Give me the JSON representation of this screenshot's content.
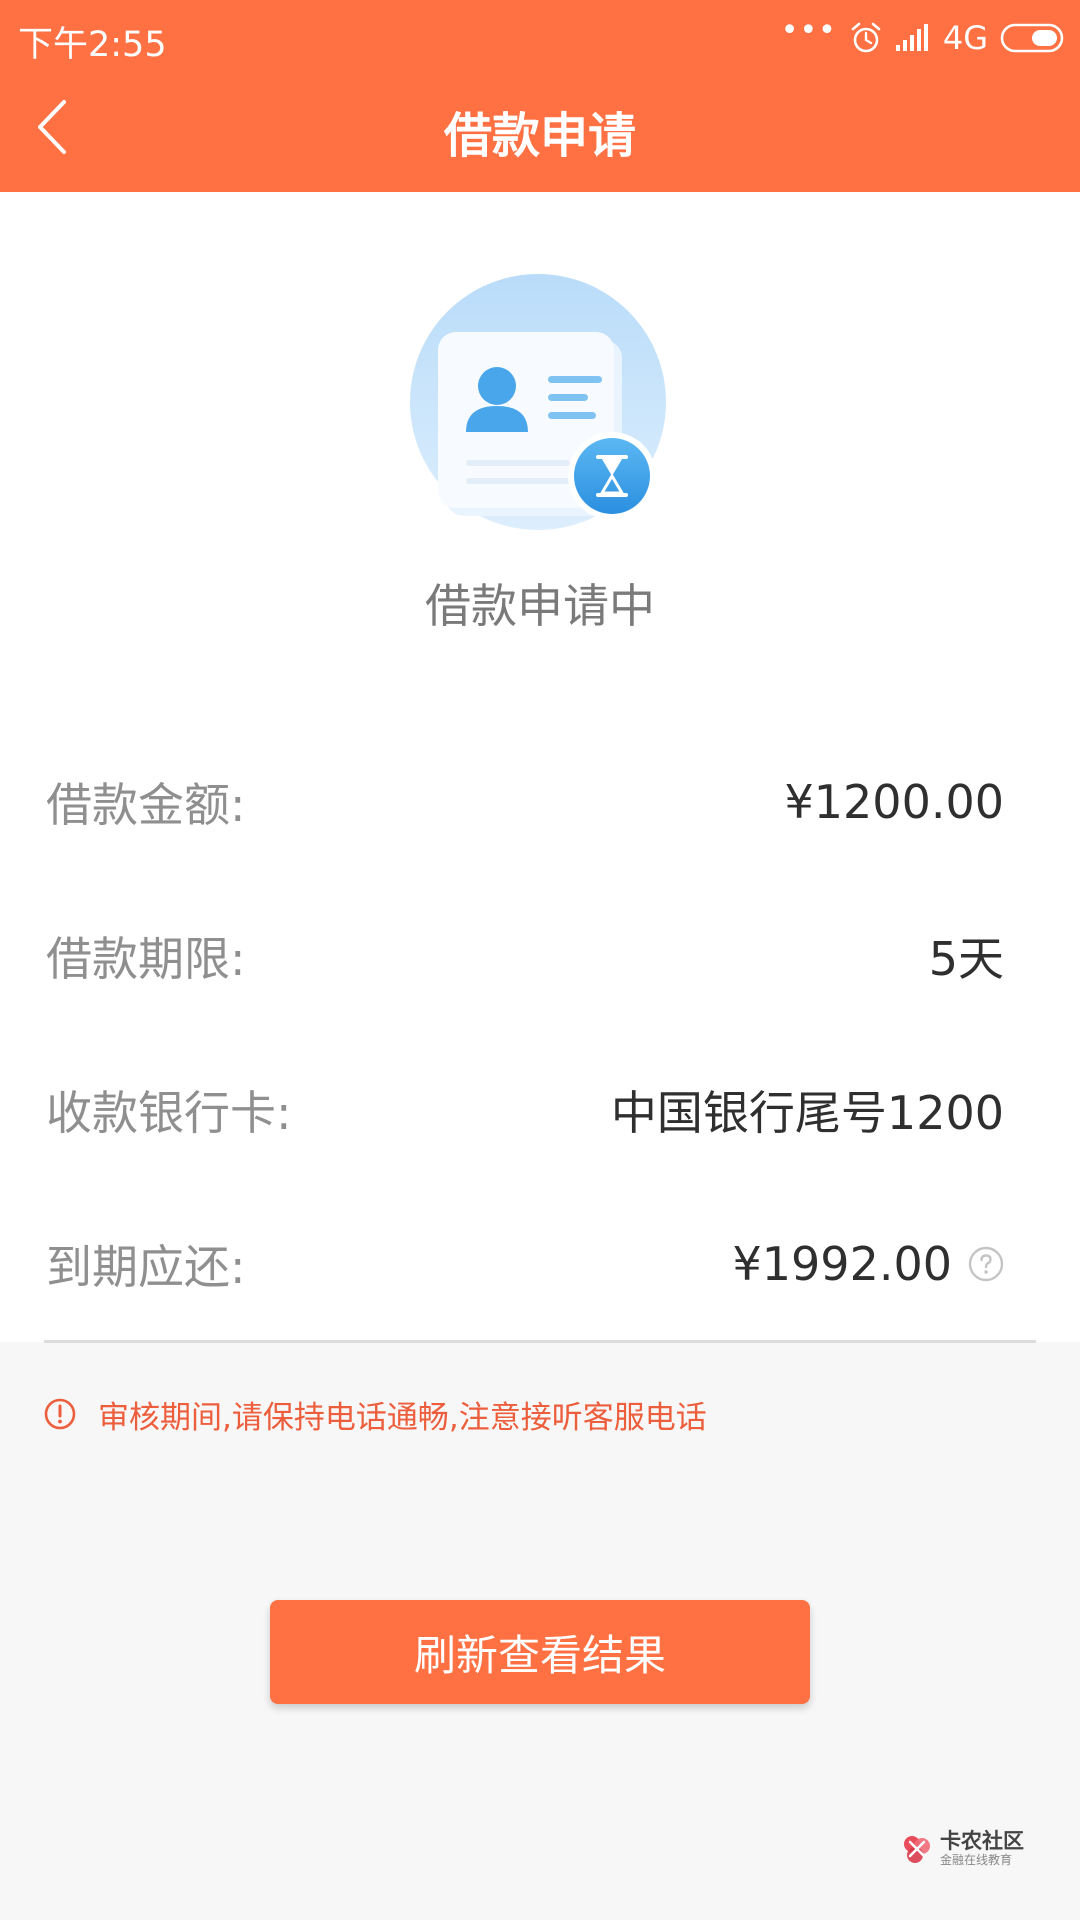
{
  "status_bar": {
    "time": "下午2:55",
    "network": "4G"
  },
  "header": {
    "title": "借款申请",
    "back_icon": "chevron-left-icon"
  },
  "application": {
    "illustration_icon": "id-card-hourglass-icon",
    "status_text": "借款申请中",
    "rows": [
      {
        "label": "借款金额:",
        "value": "¥1200.00"
      },
      {
        "label": "借款期限:",
        "value": "5天"
      },
      {
        "label": "收款银行卡:",
        "value": "中国银行尾号1200"
      },
      {
        "label": "到期应还:",
        "value": "¥1992.00",
        "help_icon": "question-circle-icon"
      }
    ]
  },
  "notice": {
    "icon": "exclamation-circle-icon",
    "text": "审核期间,请保持电话通畅,注意接听客服电话"
  },
  "refresh_button": {
    "label": "刷新查看结果"
  },
  "watermark": {
    "main": "卡农社区",
    "sub": "金融在线教育"
  },
  "colors": {
    "accent": "#ff7043",
    "notice": "#ec5e3c",
    "label": "#8f8f8f",
    "value": "#2f2f2f",
    "background": "#f7f7f7"
  }
}
